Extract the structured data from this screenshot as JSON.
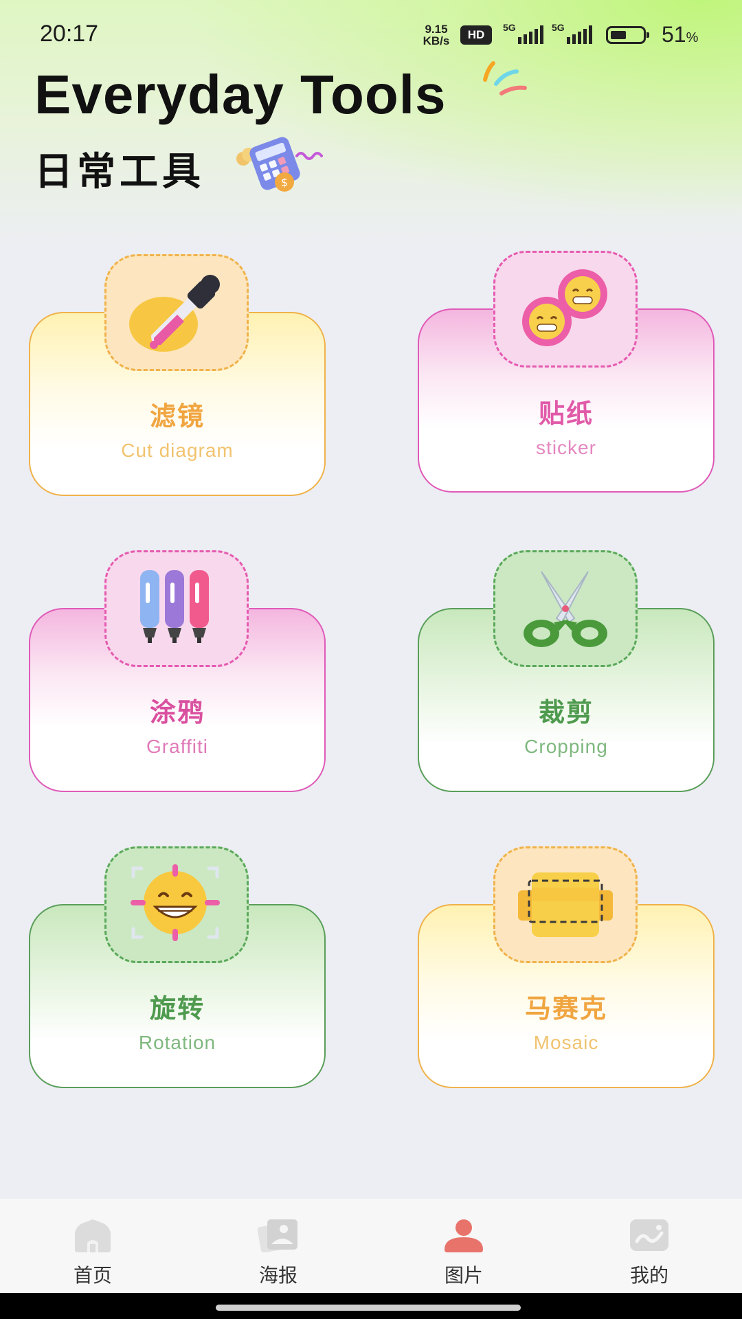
{
  "status_bar": {
    "time": "20:17",
    "net_speed_value": "9.15",
    "net_speed_unit": "KB/s",
    "hd_badge": "HD",
    "signal1_label": "5G",
    "signal2_label": "5G",
    "battery_percent": "51",
    "battery_unit": "%",
    "battery_level": 0.51
  },
  "header": {
    "title_en": "Everyday Tools",
    "title_cn": "日常工具",
    "decor_icon": "calculator-icon"
  },
  "tools": [
    {
      "title": "滤镜",
      "subtitle": "Cut diagram",
      "icon": "dropper-icon",
      "color": "#f0b24a",
      "title_color": "#f0a540",
      "sub_color": "#f1c36f"
    },
    {
      "title": "贴纸",
      "subtitle": "sticker",
      "icon": "emoji-sticker-icon",
      "color": "#e05ab8",
      "title_color": "#e05aa8",
      "sub_color": "#e488c0"
    },
    {
      "title": "涂鸦",
      "subtitle": "Graffiti",
      "icon": "markers-icon",
      "color": "#e05ab8",
      "title_color": "#d9509f",
      "sub_color": "#e07ab8"
    },
    {
      "title": "裁剪",
      "subtitle": "Cropping",
      "icon": "scissors-icon",
      "color": "#5a9e5a",
      "title_color": "#4e9a4e",
      "sub_color": "#7fb87f"
    },
    {
      "title": "旋转",
      "subtitle": "Rotation",
      "icon": "rotate-face-icon",
      "color": "#5a9e5a",
      "title_color": "#4e9a4e",
      "sub_color": "#7fb87f"
    },
    {
      "title": "马赛克",
      "subtitle": "Mosaic",
      "icon": "mosaic-icon",
      "color": "#f0b24a",
      "title_color": "#f0a540",
      "sub_color": "#f1c36f"
    }
  ],
  "nav": [
    {
      "label": "首页",
      "icon": "home-icon",
      "active": false
    },
    {
      "label": "海报",
      "icon": "poster-icon",
      "active": false
    },
    {
      "label": "图片",
      "icon": "person-icon",
      "active": true
    },
    {
      "label": "我的",
      "icon": "profile-icon",
      "active": false
    }
  ]
}
